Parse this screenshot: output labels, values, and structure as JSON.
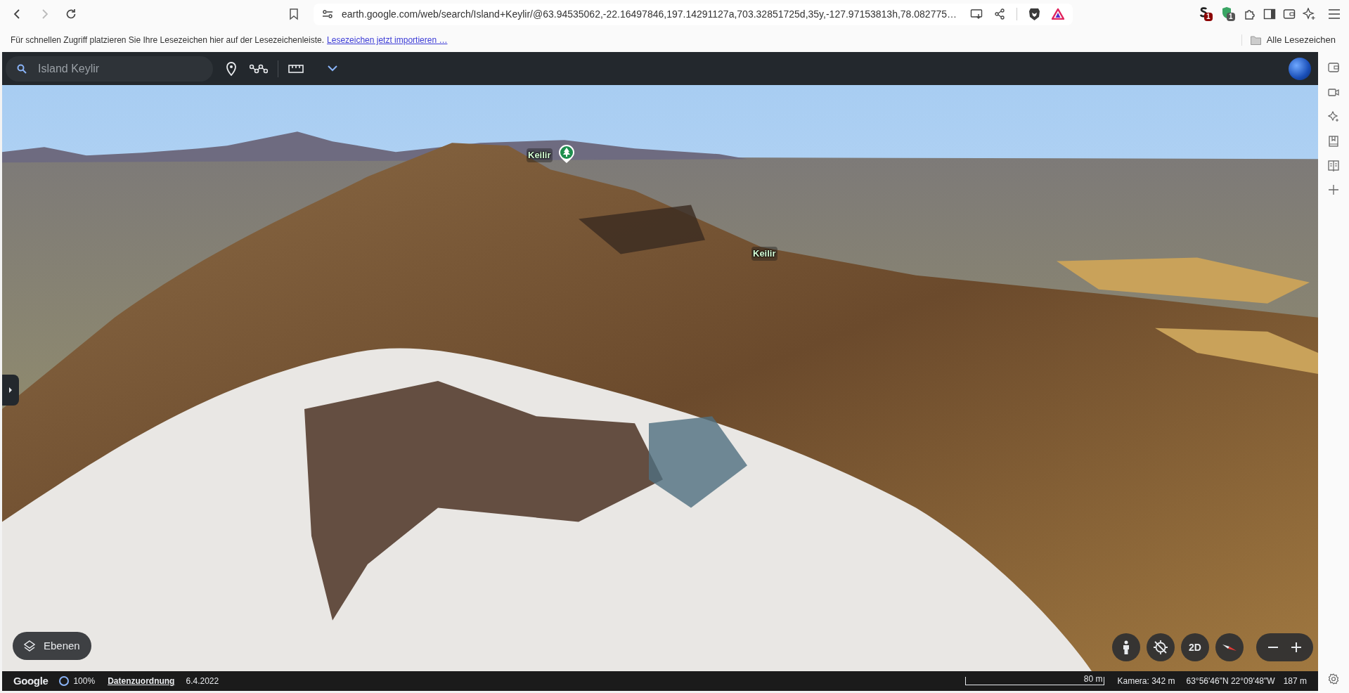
{
  "browser": {
    "url": "earth.google.com/web/search/Island+Keylir/@63.94535062,-22.16497846,197.14291127a,703.32851725d,35y,-127.97153813h,78.082775…",
    "extension_badges": [
      "1",
      "1"
    ]
  },
  "bookmarks_bar": {
    "message": "Für schnellen Zugriff platzieren Sie Ihre Lesezeichen hier auf der Lesezeichenleiste.",
    "import_link": "Lesezeichen jetzt importieren …",
    "all_bookmarks": "Alle Lesezeichen"
  },
  "earth_toolbar": {
    "search_value": "Island Keylir"
  },
  "map": {
    "labels": [
      {
        "text": "Keilir",
        "pin": true
      },
      {
        "text": "Keilir",
        "pin": false
      }
    ],
    "layers_button": "Ebenen",
    "view_mode_button": "2D"
  },
  "status_bar": {
    "brand": "Google",
    "loading": "100%",
    "attribution": "Datenzuordnung",
    "date": "6.4.2022",
    "scale": "80 m",
    "camera": "Kamera: 342 m",
    "coordinates": "63°56'46\"N 22°09'48\"W",
    "elevation": "187 m"
  }
}
